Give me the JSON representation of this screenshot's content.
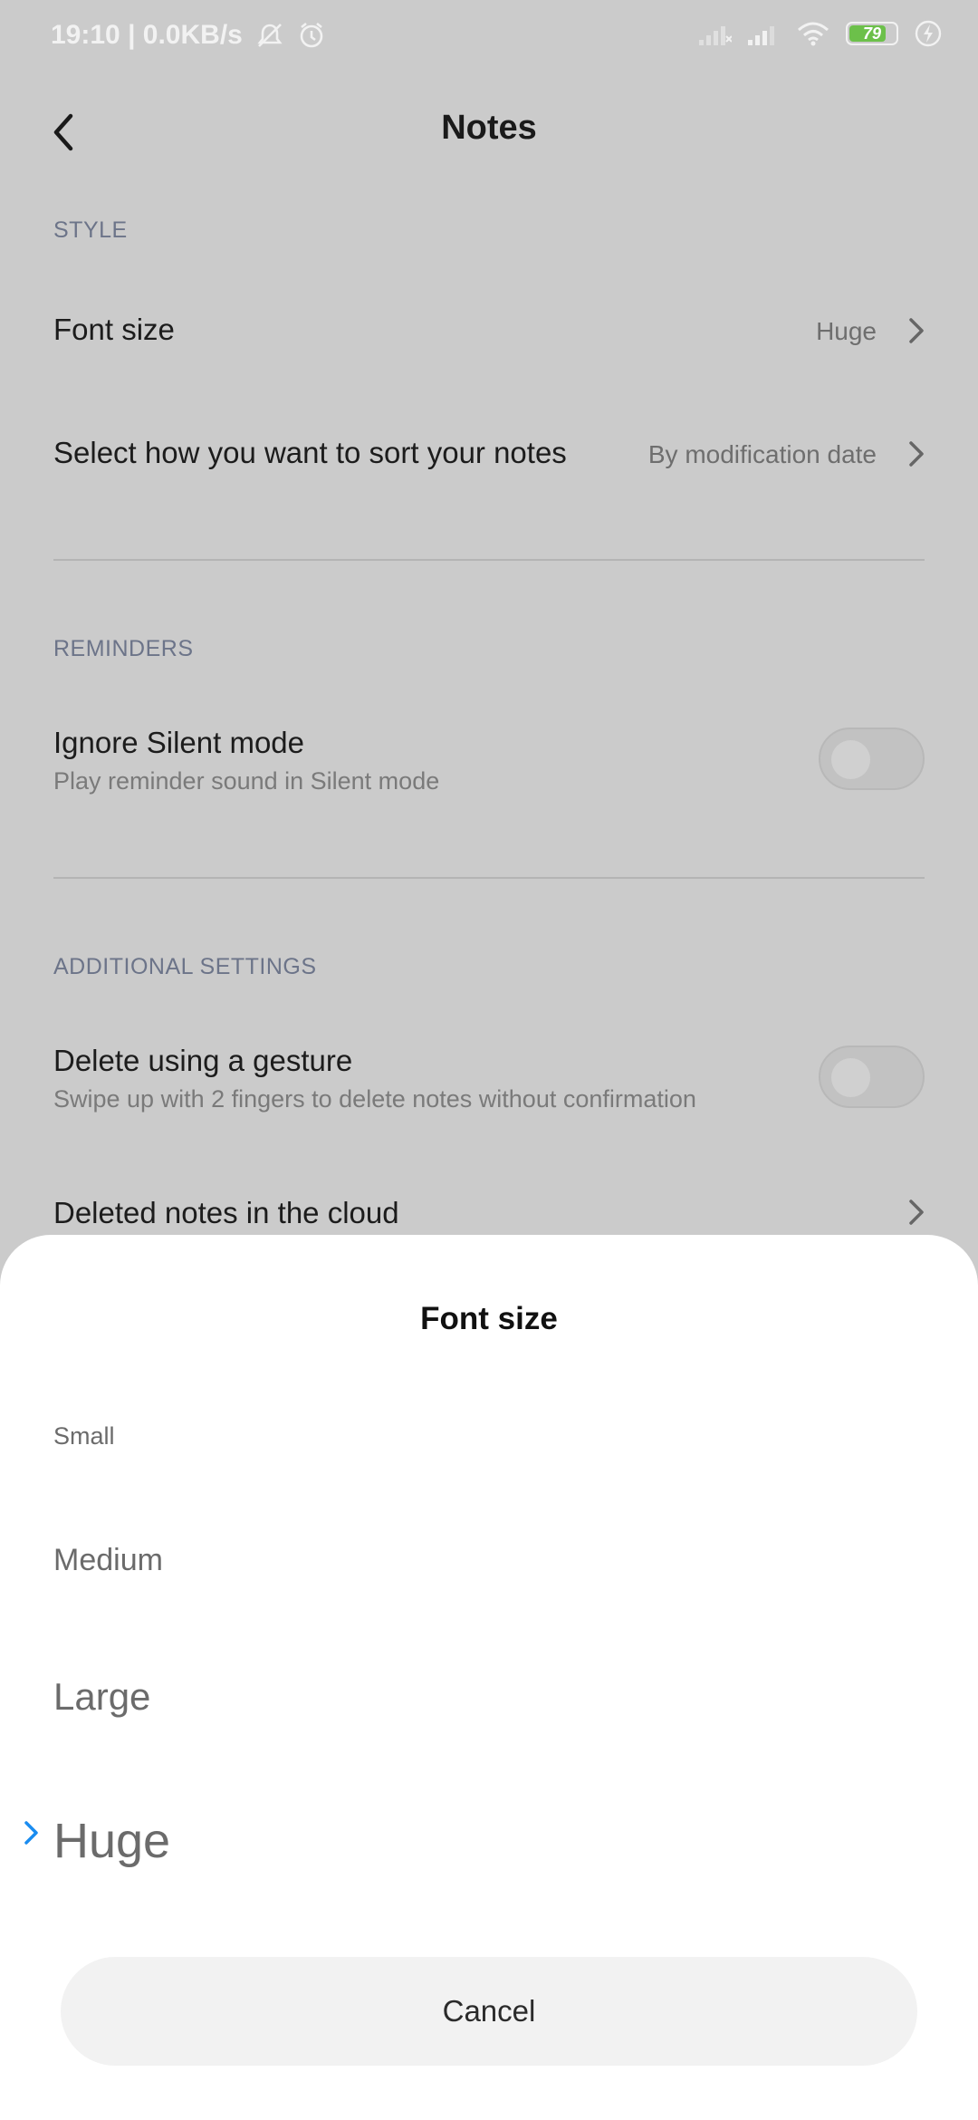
{
  "status_bar": {
    "time_speed": "19:10 | 0.0KB/s",
    "battery_level": "79",
    "battery_fraction": 0.79,
    "battery_color": "#6cc04a",
    "icons": [
      "no-alarm-icon",
      "alarm-icon",
      "signal-1-icon",
      "signal-2-icon",
      "wifi-icon",
      "battery-icon",
      "charging-icon"
    ]
  },
  "header": {
    "title": "Notes",
    "back_icon": "back-chevron-icon"
  },
  "style_section": {
    "label": "STYLE",
    "font_size": {
      "title": "Font size",
      "value": "Huge"
    },
    "sort": {
      "title": "Select how you want to sort your notes",
      "value": "By modification date"
    }
  },
  "reminders_section": {
    "label": "REMINDERS",
    "ignore_silent": {
      "title": "Ignore Silent mode",
      "subtitle": "Play reminder sound in Silent mode",
      "enabled": false
    }
  },
  "additional_section": {
    "label": "ADDITIONAL SETTINGS",
    "delete_gesture": {
      "title": "Delete using a gesture",
      "subtitle": "Swipe up with 2 fingers to delete notes without confirmation",
      "enabled": false
    },
    "deleted_cloud": {
      "title": "Deleted notes in the cloud"
    }
  },
  "sheet": {
    "title": "Font size",
    "options": [
      {
        "label": "Small",
        "selected": false
      },
      {
        "label": "Medium",
        "selected": false
      },
      {
        "label": "Large",
        "selected": false
      },
      {
        "label": "Huge",
        "selected": true
      }
    ],
    "selected_color": "#1a8cf0",
    "cancel_label": "Cancel"
  }
}
